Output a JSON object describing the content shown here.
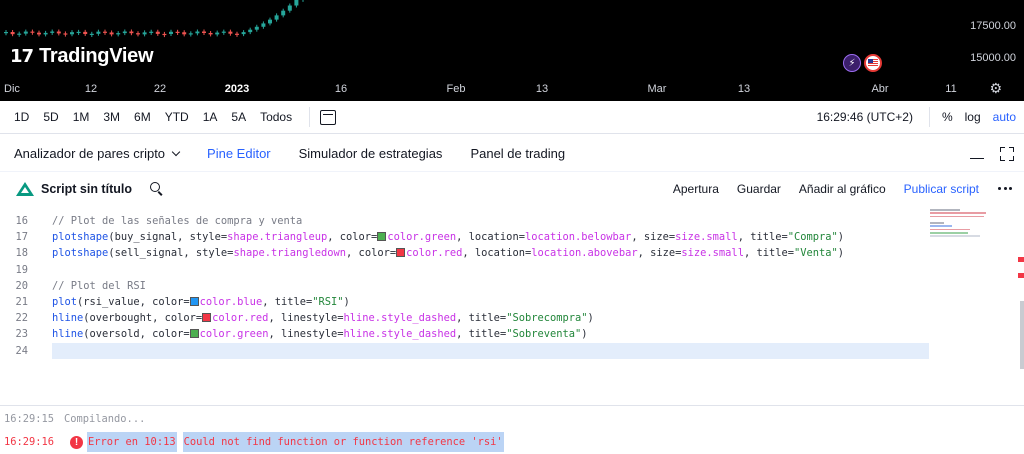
{
  "chart": {
    "prices": [
      "17500.00",
      "15000.00"
    ],
    "logo": {
      "mark": "17",
      "name": "TradingView"
    },
    "time_axis": [
      "Dic",
      "12",
      "22",
      "2023",
      "16",
      "Feb",
      "13",
      "Mar",
      "13",
      "Abr",
      "11"
    ],
    "candle_colors": {
      "up": "#26a69a",
      "down": "#ef5350"
    }
  },
  "timeframes": {
    "ranges": [
      "1D",
      "5D",
      "1M",
      "3M",
      "6M",
      "YTD",
      "1A",
      "5A",
      "Todos"
    ],
    "clock": "16:29:46 (UTC+2)",
    "options": [
      "%",
      "log",
      "auto"
    ]
  },
  "panel_tabs": {
    "items": [
      "Analizador de pares cripto",
      "Pine Editor",
      "Simulador de estrategias",
      "Panel de trading"
    ],
    "active": "Pine Editor"
  },
  "editor_toolbar": {
    "script_title": "Script sin título",
    "actions": [
      "Apertura",
      "Guardar",
      "Añadir al gráfico",
      "Publicar script"
    ]
  },
  "code": {
    "line_numbers": [
      "16",
      "17",
      "18",
      "19",
      "20",
      "21",
      "22",
      "23",
      "24"
    ],
    "lines": [
      "// Plot de las señales de compra y venta",
      "plotshape(buy_signal, style=shape.triangleup, color=color.green, location=location.belowbar, size=size.small, title=\"Compra\")",
      "plotshape(sell_signal, style=shape.triangledown, color=color.red, location=location.abovebar, size=size.small, title=\"Venta\")",
      "",
      "// Plot del RSI",
      "plot(rsi_value, color=color.blue, title=\"RSI\")",
      "hline(overbought, color=color.red, linestyle=hline.style_dashed, title=\"Sobrecompra\")",
      "hline(oversold, color=color.green, linestyle=hline.style_dashed, title=\"Sobreventa\")",
      ""
    ],
    "swatch_colors": {
      "green": "#4caf50",
      "red": "#f23645",
      "blue": "#2196f3"
    }
  },
  "console": {
    "info": {
      "time": "16:29:15",
      "message": "Compilando..."
    },
    "error": {
      "time": "16:29:16",
      "location": "Error en 10:13",
      "message": "Could not find function or function reference 'rsi'"
    }
  },
  "colors": {
    "accent": "#2962ff",
    "error": "#f23645",
    "selection": "#bbd4f5"
  }
}
